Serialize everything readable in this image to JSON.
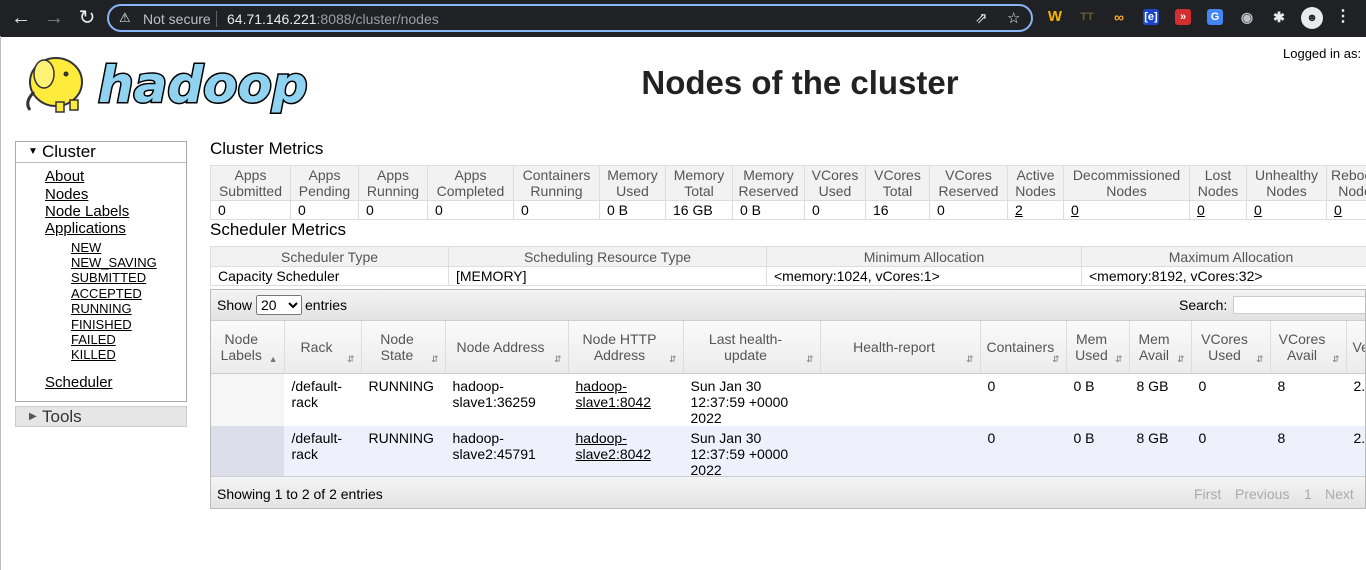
{
  "browser": {
    "security_label": "Not secure",
    "url_host": "64.71.146.221",
    "url_rest": ":8088/cluster/nodes"
  },
  "header": {
    "logo_text": "hadoop",
    "title": "Nodes of the cluster",
    "logged_in": "Logged in as:"
  },
  "sidebar": {
    "cluster_label": "Cluster",
    "links": [
      "About",
      "Nodes",
      "Node Labels",
      "Applications"
    ],
    "app_states": [
      "NEW",
      "NEW_SAVING",
      "SUBMITTED",
      "ACCEPTED",
      "RUNNING",
      "FINISHED",
      "FAILED",
      "KILLED"
    ],
    "scheduler": "Scheduler",
    "tools_label": "Tools"
  },
  "cluster_metrics": {
    "title": "Cluster Metrics",
    "headers": [
      "Apps Submitted",
      "Apps Pending",
      "Apps Running",
      "Apps Completed",
      "Containers Running",
      "Memory Used",
      "Memory Total",
      "Memory Reserved",
      "VCores Used",
      "VCores Total",
      "VCores Reserved",
      "Active Nodes",
      "Decommissioned Nodes",
      "Lost Nodes",
      "Unhealthy Nodes",
      "Rebooted Nodes"
    ],
    "values": [
      "0",
      "0",
      "0",
      "0",
      "0",
      "0 B",
      "16 GB",
      "0 B",
      "0",
      "16",
      "0",
      "2",
      "0",
      "0",
      "0",
      "0"
    ]
  },
  "scheduler_metrics": {
    "title": "Scheduler Metrics",
    "headers": [
      "Scheduler Type",
      "Scheduling Resource Type",
      "Minimum Allocation",
      "Maximum Allocation"
    ],
    "values": [
      "Capacity Scheduler",
      "[MEMORY]",
      "<memory:1024, vCores:1>",
      "<memory:8192, vCores:32>"
    ]
  },
  "nodes_table": {
    "show_label": "Show",
    "page_size": "20",
    "entries_label": "entries",
    "search_label": "Search:",
    "headers": [
      "Node Labels",
      "Rack",
      "Node State",
      "Node Address",
      "Node HTTP Address",
      "Last health-update",
      "Health-report",
      "Containers",
      "Mem Used",
      "Mem Avail",
      "VCores Used",
      "VCores Avail",
      "Version"
    ],
    "rows": [
      [
        "",
        "/default-rack",
        "RUNNING",
        "hadoop-slave1:36259",
        "hadoop-slave1:8042",
        "Sun Jan 30 12:37:59 +0000 2022",
        "",
        "0",
        "0 B",
        "8 GB",
        "0",
        "8",
        "2."
      ],
      [
        "",
        "/default-rack",
        "RUNNING",
        "hadoop-slave2:45791",
        "hadoop-slave2:8042",
        "Sun Jan 30 12:37:59 +0000 2022",
        "",
        "0",
        "0 B",
        "8 GB",
        "0",
        "8",
        "2."
      ]
    ],
    "info": "Showing 1 to 2 of 2 entries",
    "pagination": [
      "First",
      "Previous",
      "1",
      "Next"
    ]
  }
}
